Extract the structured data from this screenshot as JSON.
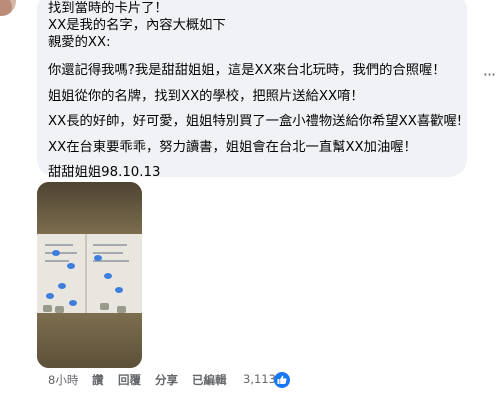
{
  "comment": {
    "lines": [
      "找到當時的卡片了！",
      "XX是我的名字，內容大概如下",
      "親愛的XX:",
      "你還記得我嗎?我是甜甜姐姐，這是XX來台北玩時，我們的合照喔！",
      "姐姐從你的名牌，找到XX的學校，把照片送給XX唷！",
      "XX長的好帥，好可愛，姐姐特別買了一盒小禮物送給你希望XX喜歡喔!",
      "XX在台東要乖乖，努力讀書，姐姐會在台北一直幫XX加油喔！",
      "甜甜姐姐98.10.13"
    ],
    "more_label": "···"
  },
  "actions": {
    "time": "8小時",
    "read": "讚",
    "reply": "回覆",
    "share": "分享",
    "edited": "已編輯",
    "reaction_count": "3,113"
  },
  "icons": {
    "like": "like-thumb-icon",
    "more": "more-options-icon"
  },
  "colors": {
    "bubble": "#f0f2f5",
    "meta_text": "#65676b",
    "like_blue": "#1877f2"
  }
}
